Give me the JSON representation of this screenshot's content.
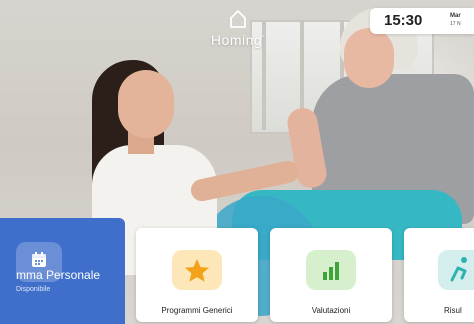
{
  "header": {
    "brand": "Homing",
    "trademark": "°",
    "logo_icon": "house-outline-icon"
  },
  "status": {
    "time": "15:30",
    "day": "Mar",
    "date": "17 N"
  },
  "tiles": {
    "personal": {
      "title": "mma Personale",
      "subtitle": "Disponibile",
      "icon": "calendar-icon",
      "color": "#3f6fca"
    },
    "generic": {
      "label": "Programmi Generici",
      "icon": "star-icon",
      "color": "#f4a21c"
    },
    "evaluations": {
      "label": "Valutazioni",
      "icon": "bar-chart-icon",
      "color": "#3fa33a"
    },
    "results": {
      "label": "Risul",
      "icon": "running-person-icon",
      "color": "#2fb3b0"
    }
  }
}
